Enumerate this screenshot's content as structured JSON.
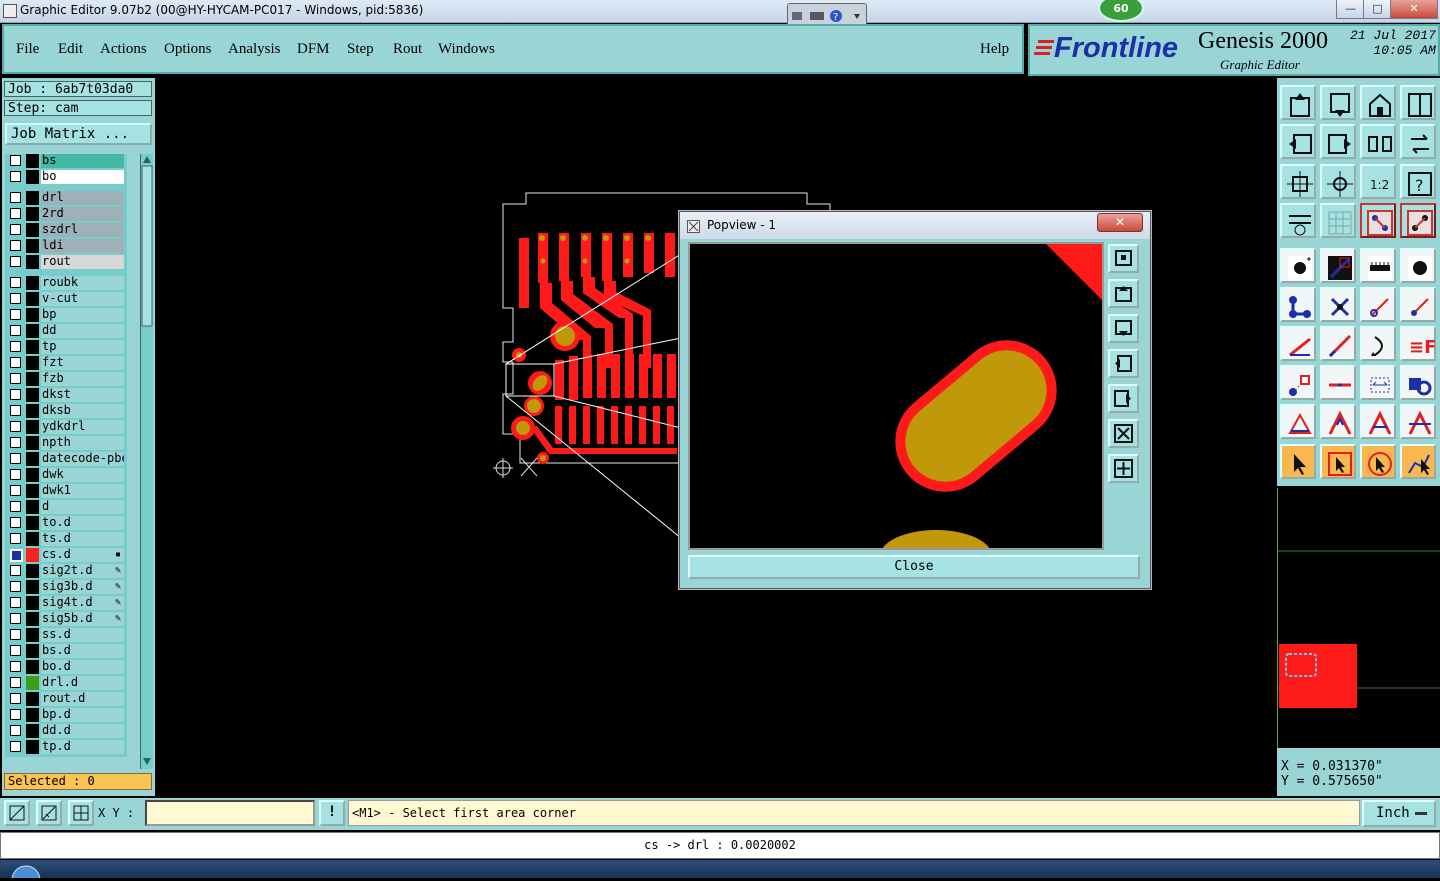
{
  "window": {
    "title": "Graphic Editor 9.07b2 (00@HY-HYCAM-PC017 - Windows, pid:5836)",
    "min_label": "—",
    "max_label": "□",
    "close_label": "✕",
    "badge": "60"
  },
  "menu": {
    "items": [
      "File",
      "Edit",
      "Actions",
      "Options",
      "Analysis",
      "DFM",
      "Step",
      "Rout",
      "Windows"
    ],
    "help": "Help"
  },
  "brand": {
    "logo": "Frontline",
    "product": "Genesis 2000",
    "subtitle": "Graphic Editor",
    "date": "21 Jul 2017",
    "time": "10:05 AM"
  },
  "left": {
    "job": "Job : 6ab7t03da0",
    "step": "Step: cam",
    "job_matrix": "Job Matrix ...",
    "selected": "Selected : 0",
    "layers": [
      {
        "name": "bs",
        "bg": "#44b8a4",
        "swatch": "#000000",
        "mark": ""
      },
      {
        "name": "bo",
        "bg": "#ffffff",
        "swatch": "#000000",
        "mark": ""
      },
      {
        "name": "drl",
        "bg": "#9fb0b8",
        "swatch": "#000000",
        "mark": ""
      },
      {
        "name": "2rd",
        "bg": "#9fb0b8",
        "swatch": "#000000",
        "mark": ""
      },
      {
        "name": "szdrl",
        "bg": "#9fb0b8",
        "swatch": "#000000",
        "mark": ""
      },
      {
        "name": "ldi",
        "bg": "#9fb0b8",
        "swatch": "#000000",
        "mark": ""
      },
      {
        "name": "rout",
        "bg": "#d8d8d8",
        "swatch": "#000000",
        "mark": ""
      },
      {
        "name": "roubk",
        "bg": "#99d5d5",
        "swatch": "#000000",
        "mark": ""
      },
      {
        "name": "v-cut",
        "bg": "#99d5d5",
        "swatch": "#000000",
        "mark": ""
      },
      {
        "name": "bp",
        "bg": "#99d5d5",
        "swatch": "#000000",
        "mark": ""
      },
      {
        "name": "dd",
        "bg": "#99d5d5",
        "swatch": "#000000",
        "mark": ""
      },
      {
        "name": "tp",
        "bg": "#99d5d5",
        "swatch": "#000000",
        "mark": ""
      },
      {
        "name": "fzt",
        "bg": "#99d5d5",
        "swatch": "#000000",
        "mark": ""
      },
      {
        "name": "fzb",
        "bg": "#99d5d5",
        "swatch": "#000000",
        "mark": ""
      },
      {
        "name": "dkst",
        "bg": "#99d5d5",
        "swatch": "#000000",
        "mark": ""
      },
      {
        "name": "dksb",
        "bg": "#99d5d5",
        "swatch": "#000000",
        "mark": ""
      },
      {
        "name": "ydkdrl",
        "bg": "#99d5d5",
        "swatch": "#000000",
        "mark": ""
      },
      {
        "name": "npth",
        "bg": "#99d5d5",
        "swatch": "#000000",
        "mark": ""
      },
      {
        "name": "datecode-pbe",
        "bg": "#99d5d5",
        "swatch": "#000000",
        "mark": ""
      },
      {
        "name": "dwk",
        "bg": "#99d5d5",
        "swatch": "#000000",
        "mark": ""
      },
      {
        "name": "dwk1",
        "bg": "#99d5d5",
        "swatch": "#000000",
        "mark": ""
      },
      {
        "name": "d",
        "bg": "#99d5d5",
        "swatch": "#000000",
        "mark": ""
      },
      {
        "name": "to.d",
        "bg": "#99d5d5",
        "swatch": "#000000",
        "mark": ""
      },
      {
        "name": "ts.d",
        "bg": "#99d5d5",
        "swatch": "#000000",
        "mark": ""
      },
      {
        "name": "cs.d",
        "bg": "#99d5d5",
        "swatch": "#ff2020",
        "mark": "▪",
        "active": true
      },
      {
        "name": "sig2t.d",
        "bg": "#99d5d5",
        "swatch": "#000000",
        "mark": "✎"
      },
      {
        "name": "sig3b.d",
        "bg": "#99d5d5",
        "swatch": "#000000",
        "mark": "✎"
      },
      {
        "name": "sig4t.d",
        "bg": "#99d5d5",
        "swatch": "#000000",
        "mark": "✎"
      },
      {
        "name": "sig5b.d",
        "bg": "#99d5d5",
        "swatch": "#000000",
        "mark": "✎"
      },
      {
        "name": "ss.d",
        "bg": "#99d5d5",
        "swatch": "#000000",
        "mark": ""
      },
      {
        "name": "bs.d",
        "bg": "#99d5d5",
        "swatch": "#000000",
        "mark": ""
      },
      {
        "name": "bo.d",
        "bg": "#99d5d5",
        "swatch": "#000000",
        "mark": ""
      },
      {
        "name": "drl.d",
        "bg": "#99d5d5",
        "swatch": "#3c9d1a",
        "mark": ""
      },
      {
        "name": "rout.d",
        "bg": "#99d5d5",
        "swatch": "#000000",
        "mark": ""
      },
      {
        "name": "bp.d",
        "bg": "#99d5d5",
        "swatch": "#000000",
        "mark": ""
      },
      {
        "name": "dd.d",
        "bg": "#99d5d5",
        "swatch": "#000000",
        "mark": ""
      },
      {
        "name": "tp.d",
        "bg": "#99d5d5",
        "swatch": "#000000",
        "mark": ""
      }
    ]
  },
  "popview": {
    "title": "Popview - 1",
    "close_x": "✕",
    "close_button": "Close"
  },
  "coords": {
    "x": "X = 0.031370\"",
    "y": "Y = 0.575650\""
  },
  "bottom": {
    "xy_label": "X Y :",
    "info_icon": "!",
    "prompt": "<M1> - Select first area corner",
    "units": "Inch",
    "status": "cs -> drl : 0.0020002"
  },
  "colors": {
    "panel": "#99d5d5",
    "copper": "#ff1a1a",
    "pad": "#c0980a",
    "selected_bar": "#f9c44f"
  }
}
